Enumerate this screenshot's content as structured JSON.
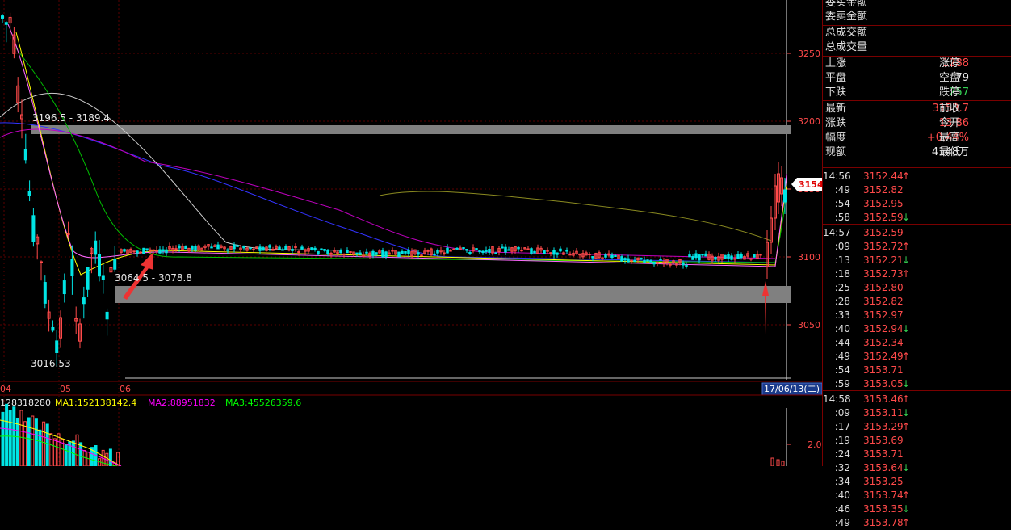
{
  "main_chart": {
    "price_axis_labels": [
      "3250",
      "3200",
      "3150",
      "3100",
      "3050"
    ],
    "current_price_tag": "3154",
    "box_top_label": "3196.5 - 3189.4",
    "box_bottom_label": "3064.5 - 3078.8",
    "low_label": "3016.53",
    "date_axis_labels": [
      "04",
      "05",
      "06"
    ],
    "date_cursor": "17/06/13(二)"
  },
  "volume_chart": {
    "legend_vol": "128318280",
    "legend_ma1": "MA1:152138142.4",
    "legend_ma2": "MA2:88951832",
    "legend_ma3": "MA3:45526359.6",
    "axis_label": "2.0",
    "colors": {
      "ma1": "#ffff00",
      "ma2": "#ff00ff",
      "ma3": "#00ff00"
    }
  },
  "info_panel": {
    "top_rows": [
      {
        "label": "委买金额"
      },
      {
        "label": "委卖金额"
      }
    ],
    "total_rows": [
      {
        "label": "总成交额"
      },
      {
        "label": "总成交量"
      }
    ],
    "breadth_rows": [
      {
        "label": "上涨",
        "value": "1288",
        "label2": "涨停",
        "color": "red"
      },
      {
        "label": "平盘",
        "value": "79",
        "label2": "空盘",
        "color": "white"
      },
      {
        "label": "下跌",
        "value": "257",
        "label2": "跌停",
        "color": "green"
      }
    ],
    "quote_rows": [
      {
        "label": "最新",
        "value": "3153.7",
        "label2": "前收",
        "color": "red"
      },
      {
        "label": "涨跌",
        "value": "13.86",
        "label2": "今开",
        "color": "red"
      },
      {
        "label": "幅度",
        "value": "+0.44%",
        "label2": "最高",
        "color": "red"
      },
      {
        "label": "现额",
        "value": "4148万",
        "label2": "最低",
        "color": "white"
      }
    ]
  },
  "ticks": [
    {
      "time": "14:56",
      "price": "3152.44",
      "dir": "up",
      "major": true
    },
    {
      "time": ":49",
      "price": "3152.82",
      "dir": "",
      "major": false
    },
    {
      "time": ":54",
      "price": "3152.95",
      "dir": "",
      "major": false
    },
    {
      "time": ":58",
      "price": "3152.59",
      "dir": "down",
      "major": false
    },
    {
      "time": "14:57",
      "price": "3152.59",
      "dir": "",
      "major": true
    },
    {
      "time": ":09",
      "price": "3152.72",
      "dir": "up",
      "major": false
    },
    {
      "time": ":13",
      "price": "3152.21",
      "dir": "down",
      "major": false
    },
    {
      "time": ":18",
      "price": "3152.73",
      "dir": "up",
      "major": false
    },
    {
      "time": ":25",
      "price": "3152.80",
      "dir": "",
      "major": false
    },
    {
      "time": ":28",
      "price": "3152.82",
      "dir": "",
      "major": false
    },
    {
      "time": ":33",
      "price": "3152.97",
      "dir": "",
      "major": false
    },
    {
      "time": ":40",
      "price": "3152.94",
      "dir": "down",
      "major": false
    },
    {
      "time": ":44",
      "price": "3152.34",
      "dir": "",
      "major": false
    },
    {
      "time": ":49",
      "price": "3152.49",
      "dir": "up",
      "major": false
    },
    {
      "time": ":54",
      "price": "3153.71",
      "dir": "",
      "major": false
    },
    {
      "time": ":59",
      "price": "3153.05",
      "dir": "down",
      "major": false
    },
    {
      "time": "14:58",
      "price": "3153.46",
      "dir": "up",
      "major": true
    },
    {
      "time": ":09",
      "price": "3153.11",
      "dir": "down",
      "major": false
    },
    {
      "time": ":17",
      "price": "3153.29",
      "dir": "up",
      "major": false
    },
    {
      "time": ":19",
      "price": "3153.69",
      "dir": "",
      "major": false
    },
    {
      "time": ":24",
      "price": "3153.71",
      "dir": "",
      "major": false
    },
    {
      "time": ":32",
      "price": "3153.64",
      "dir": "down",
      "major": false
    },
    {
      "time": ":34",
      "price": "3153.25",
      "dir": "",
      "major": false
    },
    {
      "time": ":40",
      "price": "3153.74",
      "dir": "up",
      "major": false
    },
    {
      "time": ":46",
      "price": "3153.35",
      "dir": "down",
      "major": false
    },
    {
      "time": ":49",
      "price": "3153.78",
      "dir": "up",
      "major": false
    }
  ],
  "icons": {
    "up": "↑",
    "down": "↓"
  }
}
